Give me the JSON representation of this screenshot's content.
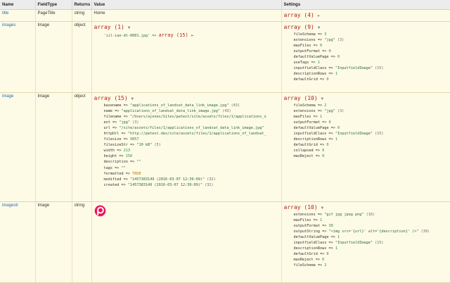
{
  "headers": [
    "Name",
    "FieldType",
    "Returns",
    "Value",
    "Settings"
  ],
  "rows": [
    {
      "name": "title",
      "fieldtype": "PageTitle",
      "returns": "string",
      "value": "Home",
      "settings_head": "array (4)"
    },
    {
      "name": "images",
      "fieldtype": "Image",
      "returns": "object",
      "value_head": "array (1)",
      "value_item_key": "'iil-ian-dt-0001.jpg' =>",
      "value_item_val": "array (15)",
      "settings_head": "array (9)",
      "settings": [
        {
          "k": "fileSchema =>",
          "v": "3",
          "t": "n"
        },
        {
          "k": "extensions =>",
          "v": "\"jpg\"",
          "t": "s",
          "c": "(3)"
        },
        {
          "k": "maxFiles =>",
          "v": "0",
          "t": "n"
        },
        {
          "k": "outputFormat =>",
          "v": "0",
          "t": "n"
        },
        {
          "k": "defaultValuePage =>",
          "v": "0",
          "t": "n"
        },
        {
          "k": "useTags =>",
          "v": "1",
          "t": "n"
        },
        {
          "k": "inputfieldClass =>",
          "v": "\"InputfieldImage\"",
          "t": "s",
          "c": "(15)"
        },
        {
          "k": "descriptionRows =>",
          "v": "1",
          "t": "n"
        },
        {
          "k": "defaultGrid =>",
          "v": "0",
          "t": "n"
        }
      ]
    },
    {
      "name": "image",
      "fieldtype": "Image",
      "returns": "object",
      "value_head": "array (15)",
      "settings_head": "array (10)",
      "values": [
        {
          "k": "basename =>",
          "v": "\"applications_of_landsat_data_link_image.jpg\"",
          "t": "s",
          "c": "(43)"
        },
        {
          "k": "name =>",
          "v": "\"applications_of_landsat_data_link_image.jpg\"",
          "t": "s",
          "c": "(43)"
        },
        {
          "k": "filename =>",
          "v": "\"/Users/ajones/Sites/pwtest/site/assets/files/1/applications_o",
          "t": "s",
          "c": ""
        },
        {
          "k": "ext =>",
          "v": "\"jpg\"",
          "t": "s",
          "c": "(3)"
        },
        {
          "k": "url =>",
          "v": "\"/site/assets/files/1/applications_of_landsat_data_link_image.jpg\"",
          "t": "s",
          "c": ""
        },
        {
          "k": "httpUrl =>",
          "v": "\"http://pwtest.dev/site/assets/files/1/applications_of_landsat_",
          "t": "s",
          "c": ""
        },
        {
          "k": "filesize =>",
          "v": "9857",
          "t": "n",
          "c": ""
        },
        {
          "k": "filesizeStr =>",
          "v": "\"10 kB\"",
          "t": "s",
          "c": "(5)"
        },
        {
          "k": "width =>",
          "v": "213",
          "t": "n",
          "c": ""
        },
        {
          "k": "height =>",
          "v": "150",
          "t": "n",
          "c": ""
        },
        {
          "k": "description =>",
          "v": "\"\"",
          "t": "s",
          "c": ""
        },
        {
          "k": "tags =>",
          "v": "\"\"",
          "t": "s",
          "c": ""
        },
        {
          "k": "formatted =>",
          "v": "TRUE",
          "t": "b",
          "c": ""
        },
        {
          "k": "modified =>",
          "v": "\"1457383149 (2016-03-07 12:39:09)\"",
          "t": "s",
          "c": "(32)"
        },
        {
          "k": "created =>",
          "v": "\"1457383149 (2016-03-07 12:39:09)\"",
          "t": "s",
          "c": "(32)"
        }
      ],
      "settings": [
        {
          "k": "fileSchema =>",
          "v": "2",
          "t": "n"
        },
        {
          "k": "extensions =>",
          "v": "\"jpg\"",
          "t": "s",
          "c": "(3)"
        },
        {
          "k": "maxFiles =>",
          "v": "1",
          "t": "n"
        },
        {
          "k": "outputFormat =>",
          "v": "0",
          "t": "n"
        },
        {
          "k": "defaultValuePage =>",
          "v": "0",
          "t": "n"
        },
        {
          "k": "inputfieldClass =>",
          "v": "\"InputfieldImage\"",
          "t": "s",
          "c": "(15)"
        },
        {
          "k": "descriptionRows =>",
          "v": "1",
          "t": "n"
        },
        {
          "k": "defaultGrid =>",
          "v": "0",
          "t": "n"
        },
        {
          "k": "collapsed =>",
          "v": "0",
          "t": "n"
        },
        {
          "k": "maxReject =>",
          "v": "0",
          "t": "n"
        }
      ]
    },
    {
      "name": "imagestr",
      "fieldtype": "Image",
      "returns": "string",
      "settings_head": "array (10)",
      "settings": [
        {
          "k": "extensions =>",
          "v": "\"gif jpg jpeg png\"",
          "t": "s",
          "c": "(16)"
        },
        {
          "k": "maxFiles =>",
          "v": "1",
          "t": "n"
        },
        {
          "k": "outputFormat =>",
          "v": "30",
          "t": "n"
        },
        {
          "k": "outputString =>",
          "v": "\"<img src='{url}' alt='{description}' />\"",
          "t": "s",
          "c": "(39)"
        },
        {
          "k": "defaultValuePage =>",
          "v": "1",
          "t": "n"
        },
        {
          "k": "inputfieldClass =>",
          "v": "\"InputfieldImage\"",
          "t": "s",
          "c": "(15)"
        },
        {
          "k": "descriptionRows =>",
          "v": "1",
          "t": "n"
        },
        {
          "k": "defaultGrid =>",
          "v": "0",
          "t": "n"
        },
        {
          "k": "maxReject =>",
          "v": "0",
          "t": "n"
        },
        {
          "k": "fileSchema =>",
          "v": "2",
          "t": "n"
        }
      ]
    }
  ]
}
